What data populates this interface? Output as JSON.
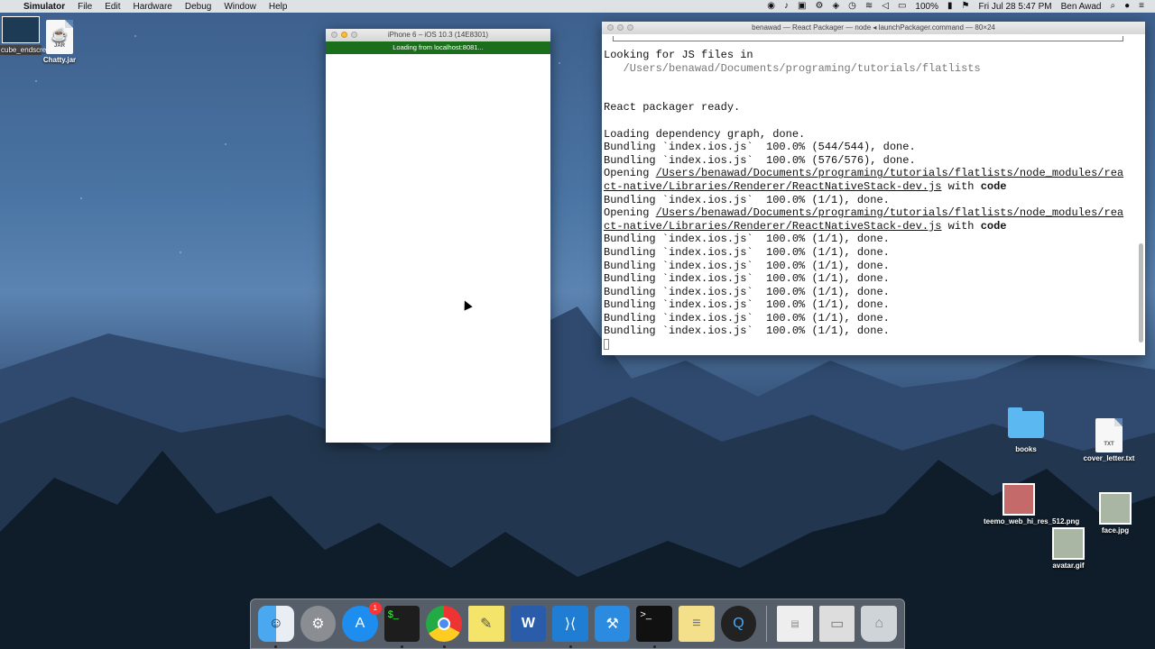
{
  "menubar": {
    "apple": "",
    "app_name": "Simulator",
    "menus": [
      "File",
      "Edit",
      "Hardware",
      "Debug",
      "Window",
      "Help"
    ],
    "battery": "100%",
    "datetime": "Fri Jul 28  5:47 PM",
    "user": "Ben Awad"
  },
  "desktop": {
    "movie_label": "cube_endscreen.mov",
    "chatty_label": "Chatty.jar",
    "chatty_tag": "JAR",
    "books_label": "books",
    "cover_label": "cover_letter.txt",
    "cover_tag": "TXT",
    "teemo_label": "teemo_web_hi_res_512.png",
    "face_label": "face.jpg",
    "avatar_label": "avatar.gif"
  },
  "simulator": {
    "title": "iPhone 6 – iOS 10.3 (14E8301)",
    "status": "Loading from localhost:8081..."
  },
  "terminal": {
    "title": "benawad — React Packager — node ◂ launchPackager.command — 80×24",
    "lines": {
      "l1": "Looking for JS files in",
      "l2": "   /Users/benawad/Documents/programing/tutorials/flatlists",
      "l3": "React packager ready.",
      "l4": "Loading dependency graph, done.",
      "l5": "Bundling `index.ios.js`  100.0% (544/544), done.",
      "l6": "Bundling `index.ios.js`  100.0% (576/576), done.",
      "opening": "Opening ",
      "path1": "/Users/benawad/Documents/programing/tutorials/flatlists/node_modules/rea",
      "path2": "ct-native/Libraries/Renderer/ReactNativeStack-dev.js",
      "with": " with ",
      "code": "code",
      "bundle": "Bundling `index.ios.js`  100.0% (1/1), done."
    }
  },
  "dock": {
    "items": [
      "Finder",
      "System Preferences",
      "App Store",
      "Terminal",
      "Chrome",
      "Stickies",
      "Word",
      "Visual Studio Code",
      "Xcode",
      "Terminal",
      "Notes",
      "QuickTime",
      "Document",
      "Preview",
      "Trash"
    ],
    "app_store_badge": "1"
  }
}
